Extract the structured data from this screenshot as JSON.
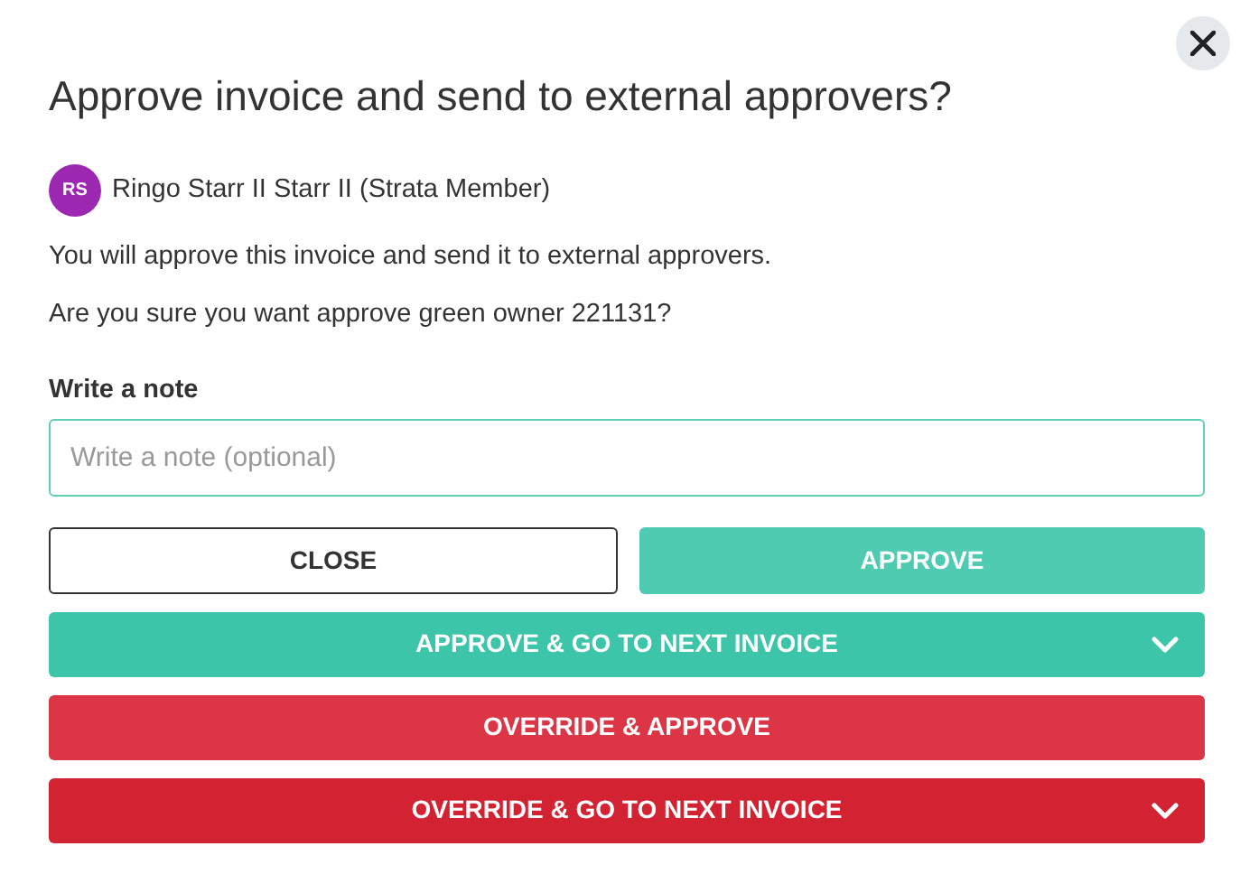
{
  "title": "Approve invoice and send to external approvers?",
  "user": {
    "initials": "RS",
    "name": "Ringo Starr II Starr II (Strata Member)"
  },
  "messages": [
    "You will approve this invoice and send it to external approvers.",
    "Are you sure you want approve green owner 221131?"
  ],
  "note": {
    "label": "Write a note",
    "placeholder": "Write a note (optional)"
  },
  "row_buttons": [
    {
      "label": "CLOSE",
      "kind": "outline"
    },
    {
      "label": "APPROVE",
      "kind": "approve"
    }
  ],
  "wide_buttons": [
    {
      "label": "APPROVE & GO TO NEXT INVOICE",
      "kind": "approve-strong",
      "menu": true
    },
    {
      "label": "OVERRIDE & APPROVE",
      "kind": "danger",
      "menu": false
    },
    {
      "label": "OVERRIDE & GO TO NEXT INVOICE",
      "kind": "danger-strong",
      "menu": true
    }
  ]
}
